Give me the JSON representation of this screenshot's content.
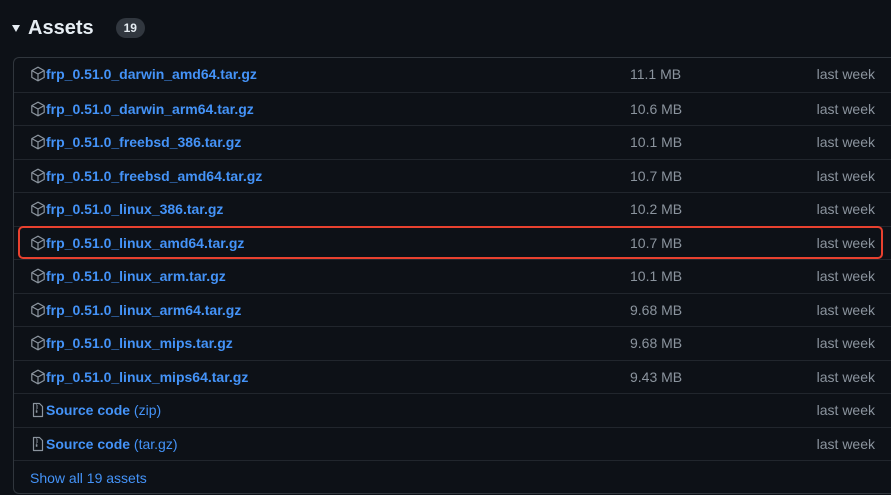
{
  "assets": {
    "title": "Assets",
    "count": "19",
    "items": [
      {
        "name": "frp_0.51.0_darwin_amd64.tar.gz",
        "size": "11.1 MB",
        "date": "last week",
        "icon": "package-icon"
      },
      {
        "name": "frp_0.51.0_darwin_arm64.tar.gz",
        "size": "10.6 MB",
        "date": "last week",
        "icon": "package-icon"
      },
      {
        "name": "frp_0.51.0_freebsd_386.tar.gz",
        "size": "10.1 MB",
        "date": "last week",
        "icon": "package-icon"
      },
      {
        "name": "frp_0.51.0_freebsd_amd64.tar.gz",
        "size": "10.7 MB",
        "date": "last week",
        "icon": "package-icon"
      },
      {
        "name": "frp_0.51.0_linux_386.tar.gz",
        "size": "10.2 MB",
        "date": "last week",
        "icon": "package-icon"
      },
      {
        "name": "frp_0.51.0_linux_amd64.tar.gz",
        "size": "10.7 MB",
        "date": "last week",
        "icon": "package-icon",
        "highlighted": true
      },
      {
        "name": "frp_0.51.0_linux_arm.tar.gz",
        "size": "10.1 MB",
        "date": "last week",
        "icon": "package-icon"
      },
      {
        "name": "frp_0.51.0_linux_arm64.tar.gz",
        "size": "9.68 MB",
        "date": "last week",
        "icon": "package-icon"
      },
      {
        "name": "frp_0.51.0_linux_mips.tar.gz",
        "size": "9.68 MB",
        "date": "last week",
        "icon": "package-icon"
      },
      {
        "name": "frp_0.51.0_linux_mips64.tar.gz",
        "size": "9.43 MB",
        "date": "last week",
        "icon": "package-icon"
      },
      {
        "name": "Source code",
        "ext": "(zip)",
        "size": "",
        "date": "last week",
        "icon": "file-zip-icon"
      },
      {
        "name": "Source code",
        "ext": "(tar.gz)",
        "size": "",
        "date": "last week",
        "icon": "file-zip-icon"
      }
    ],
    "show_all": "Show all 19 assets"
  },
  "colors": {
    "background": "#0d1117",
    "link": "#4493f8",
    "muted": "#8b949e",
    "highlight": "#e8412f"
  }
}
